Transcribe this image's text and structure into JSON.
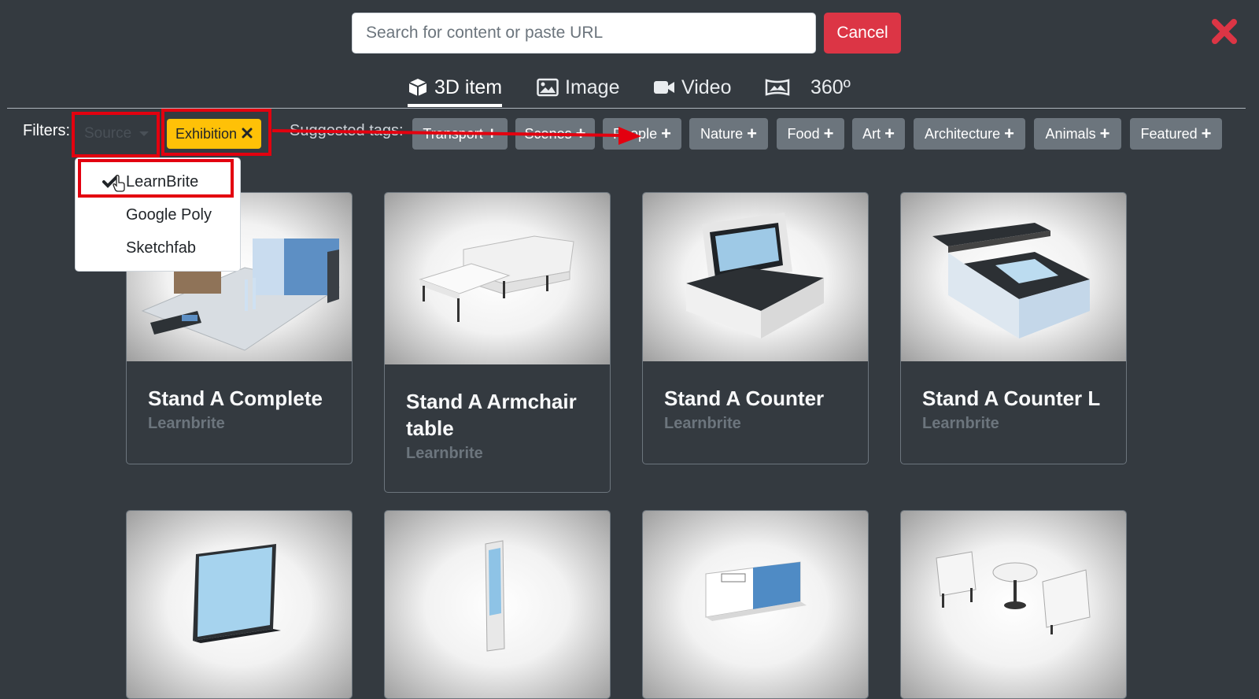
{
  "search": {
    "placeholder": "Search for content or paste URL"
  },
  "top": {
    "cancel_label": "Cancel",
    "close_icon": "close-icon",
    "close_color": "#dc3545"
  },
  "tabs": [
    {
      "label": "3D item",
      "icon": "cube-icon",
      "active": true
    },
    {
      "label": "Image",
      "icon": "image-icon",
      "active": false
    },
    {
      "label": "Video",
      "icon": "video-camera-icon",
      "active": false
    },
    {
      "label": "360º",
      "icon": "panorama-icon",
      "active": false
    }
  ],
  "filters": {
    "label": "Filters:",
    "source_label": "Source",
    "active_tag": "Exhibition",
    "suggested_label": "Suggested tags:",
    "suggested_tags": [
      "Transport",
      "Scenes",
      "People",
      "Nature",
      "Food",
      "Art",
      "Architecture",
      "Animals",
      "Featured"
    ]
  },
  "source_dropdown": {
    "items": [
      {
        "label": "LearnBrite",
        "checked": true
      },
      {
        "label": "Google Poly",
        "checked": false
      },
      {
        "label": "Sketchfab",
        "checked": false
      }
    ]
  },
  "cards": [
    {
      "title": "Stand A Complete",
      "author": "Learnbrite"
    },
    {
      "title": "Stand A Armchair table",
      "author": "Learnbrite"
    },
    {
      "title": "Stand A Counter",
      "author": "Learnbrite"
    },
    {
      "title": "Stand A Counter L",
      "author": "Learnbrite"
    },
    {
      "title": "",
      "author": ""
    },
    {
      "title": "",
      "author": ""
    },
    {
      "title": "",
      "author": ""
    },
    {
      "title": "",
      "author": ""
    }
  ],
  "colors": {
    "background": "#343a40",
    "danger": "#dc3545",
    "warning": "#ffc107",
    "tag": "#6c757d",
    "annotation": "#e3000f"
  }
}
